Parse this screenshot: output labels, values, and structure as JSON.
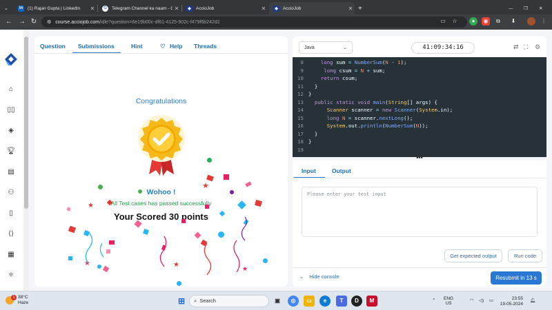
{
  "browser": {
    "tabs": [
      {
        "title": "(1) Rajan Gupta | LinkedIn",
        "icon": "linkedin-icon"
      },
      {
        "title": "Telegram Channel ka naam - Go",
        "icon": "google-icon"
      },
      {
        "title": "AccioJob",
        "icon": "acciojob-icon"
      },
      {
        "title": "AccioJob",
        "icon": "acciojob-icon",
        "active": true
      }
    ],
    "new_tab": "+",
    "url_domain": "course.acciojob.com",
    "url_path": "/idle?question=6e19b00c-df61-4125-902c-f479f6b242d2"
  },
  "left_panel": {
    "tabs": [
      "Question",
      "Submissions",
      "Hint",
      "Help",
      "Threads"
    ],
    "active_tab": "Submissions",
    "congrats_title": "Congratulations",
    "wohoo": "Wohoo !",
    "passed_text": "All Test cases has passed successfully",
    "score_text": "Your Scored 30 points"
  },
  "editor": {
    "language": "Java",
    "timer": "41:09:34:16",
    "lines": [
      {
        "n": "8",
        "text": "    long sum = NumberSum(N - 1);"
      },
      {
        "n": "9",
        "text": "     long csum = N + sum;"
      },
      {
        "n": "10",
        "text": "    return csum;"
      },
      {
        "n": "11",
        "text": "  }"
      },
      {
        "n": "12",
        "text": "}"
      },
      {
        "n": "13",
        "text": "  public static void main(String[] args) {"
      },
      {
        "n": "14",
        "text": "      Scanner scanner = new Scanner(System.in);"
      },
      {
        "n": "15",
        "text": "      long N = scanner.nextLong();"
      },
      {
        "n": "16",
        "text": "      System.out.println(NumberSum(N));"
      },
      {
        "n": "17",
        "text": "  }"
      },
      {
        "n": "18",
        "text": "}"
      },
      {
        "n": "19",
        "text": ""
      }
    ]
  },
  "console": {
    "tabs": [
      "Input",
      "Output"
    ],
    "active_tab": "Input",
    "input_placeholder": "Please enter your test input",
    "expected_btn": "Get expected output",
    "run_btn": "Run code",
    "hide_console": "Hide console",
    "resubmit_btn": "Resubmit in 13 s"
  },
  "taskbar": {
    "weather_temp": "38°C",
    "weather_desc": "Haze",
    "search_placeholder": "Search",
    "lang_line1": "ENG",
    "lang_line2": "US",
    "time": "23:55",
    "date": "19-05-2024",
    "badge_count": "1"
  },
  "colors": {
    "accent": "#2b77d4",
    "tab_text": "#1a6fb5",
    "success": "#1f9c4a",
    "editor_bg": "#263238"
  }
}
